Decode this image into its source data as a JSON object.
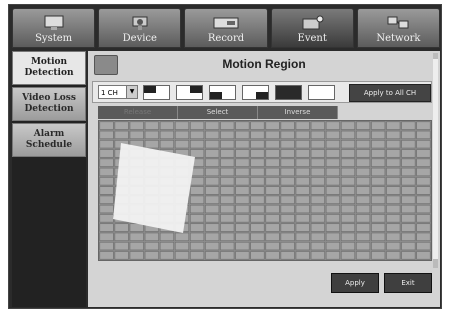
{
  "tabs": [
    {
      "label": "System"
    },
    {
      "label": "Device"
    },
    {
      "label": "Record"
    },
    {
      "label": "Event"
    },
    {
      "label": "Network"
    }
  ],
  "active_tab": "Event",
  "sidebar": {
    "items": [
      {
        "label": "Motion Detection"
      },
      {
        "label": "Video Loss Detection"
      },
      {
        "label": "Alarm Schedule"
      }
    ],
    "active": "Motion Detection"
  },
  "content": {
    "title": "Motion Region",
    "channel_select": {
      "value": "1 CH"
    },
    "apply_all_label": "Apply to All CH",
    "selection_tools": [
      {
        "label": "Release"
      },
      {
        "label": "Select"
      },
      {
        "label": "Inverse"
      }
    ],
    "buttons": {
      "apply": "Apply",
      "exit": "Exit"
    }
  },
  "colors": {
    "frame": "#2b2b2b",
    "content_bg": "#d4d4d4",
    "grid_cell": "#8c8c8c",
    "selected_region": "#f2f2f2"
  }
}
